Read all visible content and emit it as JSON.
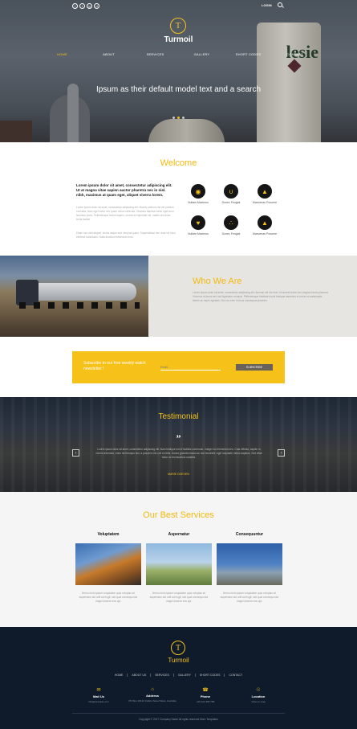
{
  "header": {
    "social_icons": [
      "facebook-icon",
      "twitter-icon",
      "google-plus-icon",
      "dribbble-icon"
    ],
    "login_label": "LOGIN",
    "logo_letter": "T",
    "brand": "Turmoil",
    "nav": [
      "HOME",
      "ABOUT",
      "SERVICES",
      "GALLERY",
      "SHORT CODES",
      "CONTACT"
    ],
    "hero_caption": "Ipsum as their default model text and a search",
    "hero_background_text": "lesie"
  },
  "welcome": {
    "title": "Welcome",
    "lead": "Lorem ipsum dolor sit amet, consectetur adipiscing elit. Ut at magna vitae sapien auctor pharetra nec in nisl. nibh, maximus at quam eget, aliquet viverra lorem.",
    "paragraph1": "Lorem ipsum dolor sit amet, consectetur adipiscing elit. Mauris pretium nisi vel pretium convallis. Nam eget tortor nec quam varius vehicula. Vivamus dapibus tortor eget arcu faucibus porta. Pellentesque lectus sapien, ornare et imperdiet vel, mattis sed dolor. Nulla facilisi.",
    "paragraph2": "Etiam nec velit aliquet, luctus neque sed, tempus quam. Suspendisse nec urna vel risus eleifend sollicitudin. Nulla tincidunt bibendum eros.",
    "features": [
      {
        "icon": "target-icon",
        "label": "Nullam Maximus"
      },
      {
        "icon": "magnet-icon",
        "label": "Donec Feugiat"
      },
      {
        "icon": "bell-icon",
        "label": "Maecenas Posuere"
      },
      {
        "icon": "heart-icon",
        "label": "Nullam Maximus"
      },
      {
        "icon": "paw-icon",
        "label": "Donec Feugiat"
      },
      {
        "icon": "bell-icon",
        "label": "Maecenas Posuere"
      }
    ]
  },
  "who": {
    "title": "Who We Are",
    "text": "Lorem ipsum dolor sit amet, consectetur adipiscing elit. Aenean vel dui erat. Ut laoreet tortor nec magna rutrum placerat. Vivamus at lacus sed nisi dignissim volutpat. Pellentesque habitant morbi tristique senectus et netus et malesuada fames ac turpis egestas. Sed ac enim id risus consequat pharetra."
  },
  "subscribe": {
    "label": "Subscribe to our free weekly watch newsletter !",
    "placeholder": "Email...",
    "button": "SUBSCRIBE"
  },
  "testimonial": {
    "title": "Testimonial",
    "quote_mark": "”",
    "text": "Lorem ipsum dolor sit amet, consectetur adipiscing elit. Nam tristique est et facilisis commodo. Integer eu fermentum leo. Cras efficitur, sapien in viverra interdum, enim nisl tempus nisl, a posuere nisi orci eu felis. Donec gravida massa ac nisi hendrerit, eget vulputate metus dapibus. Sed vitae tortor ac leo faucibus sodales.",
    "name": "MARIE DOEVEN",
    "prev": "‹",
    "next": "›"
  },
  "services": {
    "title": "Our Best Services",
    "items": [
      {
        "title": "Voluptatem",
        "text": "Nemo enim ipsam voluptatem quia voluptas sit aspernatur aut odit aut fugit, sed quia consequuntur magni dolores eos qui."
      },
      {
        "title": "Aspernatur",
        "text": "Nemo enim ipsam voluptatem quia voluptas sit aspernatur aut odit aut fugit, sed quia consequuntur magni dolores eos qui."
      },
      {
        "title": "Consequuntur",
        "text": "Nemo enim ipsam voluptatem quia voluptas sit aspernatur aut odit aut fugit, sed quia consequuntur magni dolores eos qui."
      }
    ]
  },
  "footer": {
    "logo_letter": "T",
    "brand": "Turmoil",
    "nav": [
      "HOME",
      "ABOUT US",
      "SERVICES",
      "GALLERY",
      "SHORT CODES",
      "CONTACT"
    ],
    "info": [
      {
        "icon": "mail-icon",
        "title": "Mail Us",
        "value": "info@example.com"
      },
      {
        "icon": "home-icon",
        "title": "Address",
        "value": "PO Box 16122 Collins Street West, Australia"
      },
      {
        "icon": "phone-icon",
        "title": "Phone",
        "value": "+00 123 456 789"
      },
      {
        "icon": "globe-icon",
        "title": "Location",
        "value": "View on map"
      }
    ],
    "copyright": "Copyright © 2017 Company Name All rights reserved More Templates"
  },
  "colors": {
    "accent": "#f6c21a",
    "footer_bg": "#0f1a2a",
    "who_bg": "#e6e5e1"
  }
}
